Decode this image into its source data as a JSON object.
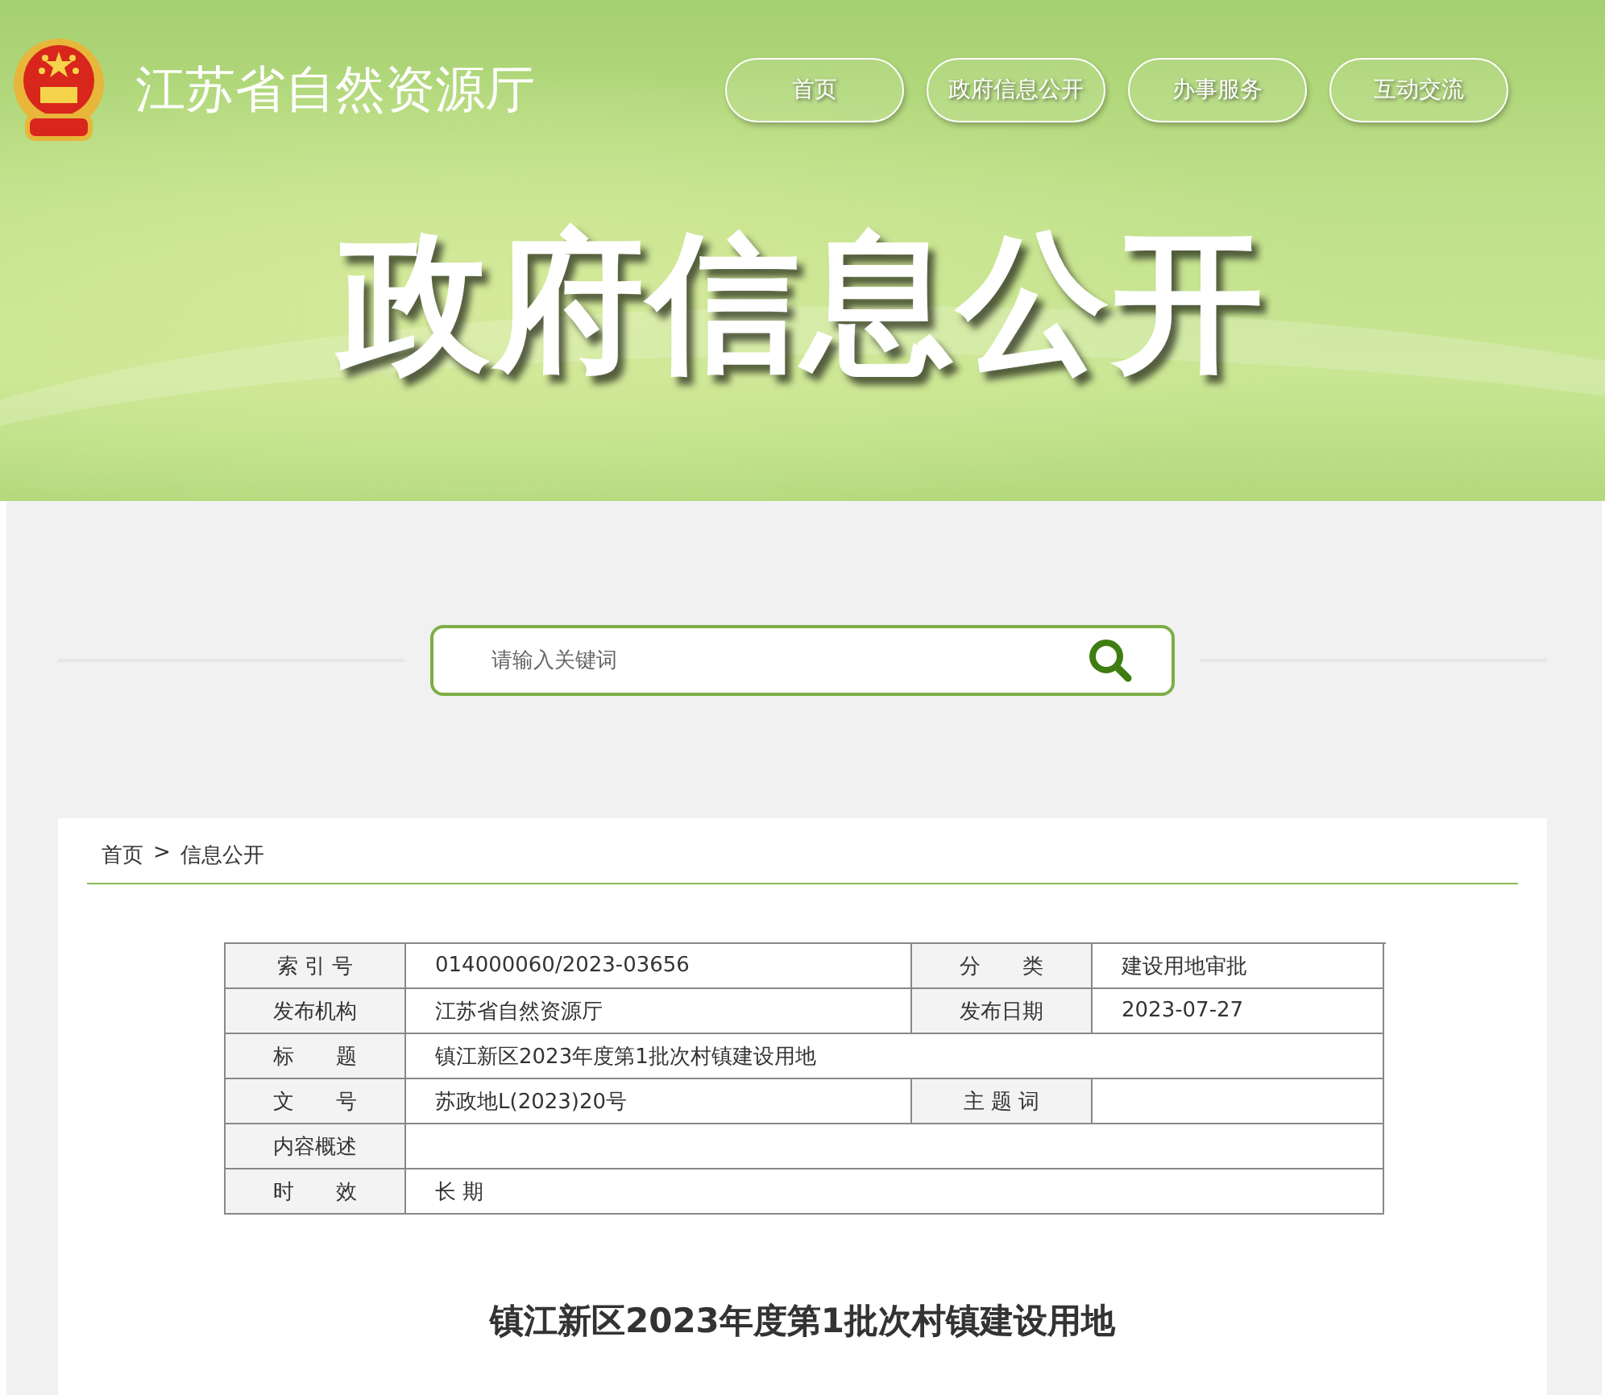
{
  "site": {
    "title": "江苏省自然资源厅",
    "nav": [
      {
        "label": "首页"
      },
      {
        "label": "政府信息公开"
      },
      {
        "label": "办事服务"
      },
      {
        "label": "互动交流"
      }
    ]
  },
  "banner_title": "政府信息公开",
  "search": {
    "placeholder": "请输入关键词"
  },
  "breadcrumb": {
    "items": [
      "首页",
      "信息公开"
    ],
    "separator": ">"
  },
  "table": {
    "rows": [
      {
        "cells": [
          {
            "kind": "label",
            "text": "索 引 号"
          },
          {
            "kind": "value",
            "text": "014000060/2023-03656"
          },
          {
            "kind": "label",
            "text": "分　　类"
          },
          {
            "kind": "value",
            "text": "建设用地审批"
          }
        ]
      },
      {
        "cells": [
          {
            "kind": "label",
            "text": "发布机构"
          },
          {
            "kind": "value",
            "text": "江苏省自然资源厅"
          },
          {
            "kind": "label",
            "text": "发布日期"
          },
          {
            "kind": "value",
            "text": "2023-07-27"
          }
        ]
      },
      {
        "cells": [
          {
            "kind": "label",
            "text": "标　　题"
          },
          {
            "kind": "value",
            "text": "镇江新区2023年度第1批次村镇建设用地"
          }
        ]
      },
      {
        "cells": [
          {
            "kind": "label",
            "text": "文　　号"
          },
          {
            "kind": "value",
            "text": "苏政地L(2023)20号"
          },
          {
            "kind": "label",
            "text": "主 题 词"
          },
          {
            "kind": "value"
          }
        ]
      },
      {
        "cells": [
          {
            "kind": "label",
            "text": "内容概述"
          },
          {
            "kind": "value"
          }
        ]
      },
      {
        "cells": [
          {
            "kind": "label",
            "text": "时　　效"
          },
          {
            "kind": "value",
            "text": "长 期"
          }
        ]
      }
    ]
  },
  "article_title": "镇江新区2023年度第1批次村镇建设用地"
}
